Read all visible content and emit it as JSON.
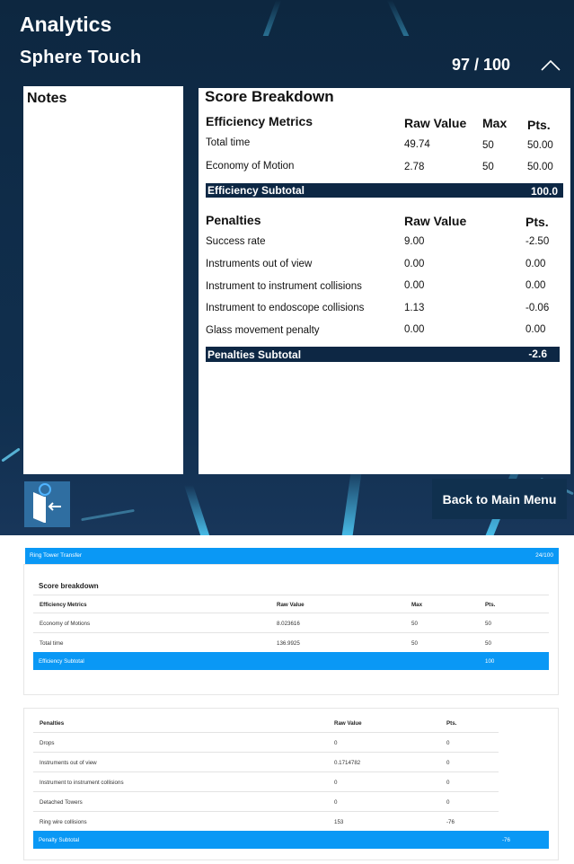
{
  "vr": {
    "title": "Analytics",
    "task": "Sphere Touch",
    "score": "97 / 100",
    "notes_title": "Notes",
    "breakdown_title": "Score Breakdown",
    "efficiency": {
      "section": "Efficiency Metrics",
      "col_raw": "Raw Value",
      "col_max": "Max",
      "col_pts": "Pts.",
      "rows": [
        {
          "metric": "Total time",
          "raw": "49.74",
          "max": "50",
          "pts": "50.00"
        },
        {
          "metric": "Economy of Motion",
          "raw": "2.78",
          "max": "50",
          "pts": "50.00"
        }
      ],
      "subtotal_label": "Efficiency Subtotal",
      "subtotal_value": "100.0"
    },
    "penalties": {
      "section": "Penalties",
      "col_raw": "Raw Value",
      "col_pts": "Pts.",
      "rows": [
        {
          "metric": "Success rate",
          "raw": "9.00",
          "pts": "-2.50"
        },
        {
          "metric": "Instruments out of view",
          "raw": "0.00",
          "pts": "0.00"
        },
        {
          "metric": "Instrument to instrument collisions",
          "raw": "0.00",
          "pts": "0.00"
        },
        {
          "metric": "Instrument to endoscope collisions",
          "raw": "1.13",
          "pts": "-0.06"
        },
        {
          "metric": "Glass movement penalty",
          "raw": "0.00",
          "pts": "0.00"
        }
      ],
      "subtotal_label": "Penalties Subtotal",
      "subtotal_value": "-2.6"
    },
    "back_button": "Back to Main Menu",
    "icons": {
      "collapse": "chevron-up-icon",
      "back": "exit-door-icon"
    }
  },
  "report": {
    "task": "Ring Tower Transfer",
    "score": "24/100",
    "breakdown_title": "Score breakdown",
    "efficiency": {
      "col_metric": "Efficiency Metrics",
      "col_raw": "Raw Value",
      "col_max": "Max",
      "col_pts": "Pts.",
      "rows": [
        {
          "metric": "Economy of Motions",
          "raw": "8.023616",
          "max": "50",
          "pts": "50"
        },
        {
          "metric": "Total time",
          "raw": "136.9925",
          "max": "50",
          "pts": "50"
        }
      ],
      "subtotal_label": "Efficiency Subtotal",
      "subtotal_value": "100"
    },
    "penalties": {
      "col_metric": "Penalties",
      "col_raw": "Raw Value",
      "col_pts": "Pts.",
      "rows": [
        {
          "metric": "Drops",
          "raw": "0",
          "pts": "0"
        },
        {
          "metric": "Instruments out of view",
          "raw": "0.1714782",
          "pts": "0"
        },
        {
          "metric": "Instrument to instrument collisions",
          "raw": "0",
          "pts": "0"
        },
        {
          "metric": "Detached Towers",
          "raw": "0",
          "pts": "0"
        },
        {
          "metric": "Ring wire collisions",
          "raw": "153",
          "pts": "-76"
        }
      ],
      "subtotal_label": "Penalty Subtotal",
      "subtotal_value": "-76"
    }
  },
  "colors": {
    "vr_background": "#0f2c49",
    "vr_subtotal_bar": "#0d2744",
    "vr_button": "#10304e",
    "vr_icon_button": "#2f6ea1",
    "report_accent": "#0a98f5"
  }
}
